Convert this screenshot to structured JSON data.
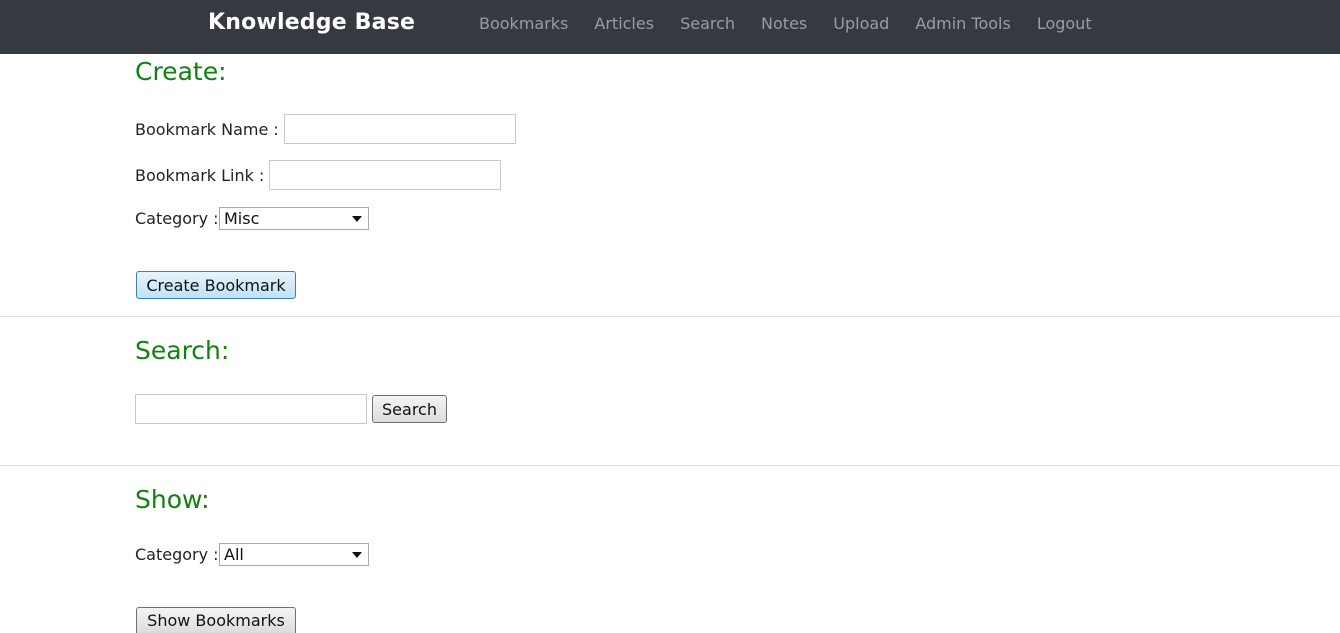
{
  "header": {
    "brand": "Knowledge Base",
    "nav": [
      "Bookmarks",
      "Articles",
      "Search",
      "Notes",
      "Upload",
      "Admin Tools",
      "Logout"
    ]
  },
  "create": {
    "title": "Create:",
    "name_label": "Bookmark Name :",
    "name_value": "",
    "link_label": "Bookmark Link :",
    "link_value": "",
    "category_label": "Category :",
    "category_value": "Misc",
    "button": "Create Bookmark"
  },
  "search": {
    "title": "Search:",
    "query_value": "",
    "button": "Search"
  },
  "show": {
    "title": "Show:",
    "category_label": "Category :",
    "category_value": "All",
    "button": "Show Bookmarks"
  }
}
